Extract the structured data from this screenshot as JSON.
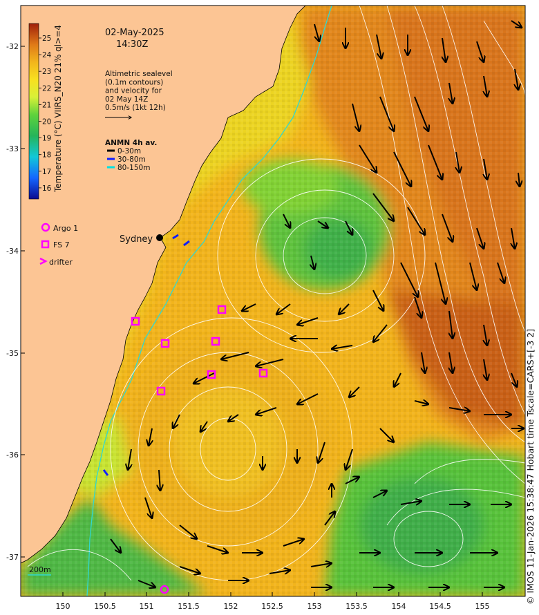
{
  "date": "02-May-2025",
  "time": "14:30Z",
  "altimetry_note": [
    "Altimetric sealevel",
    "(0.1m contours)",
    "and velocity for",
    "02 May 14Z",
    "0.5m/s (1kt 12h)"
  ],
  "anmn_title": "ANMN 4h av.",
  "anmn_items": [
    {
      "label": "0-30m",
      "color": "#000000"
    },
    {
      "label": "30-80m",
      "color": "#1020ff"
    },
    {
      "label": "80-150m",
      "color": "#00e0e0"
    }
  ],
  "colorbar": {
    "title": "Temperature (°C) VIIRS_N20 21% ql>=4",
    "ticks": [
      "25",
      "24",
      "23",
      "22",
      "21",
      "20",
      "19",
      "18",
      "17",
      "16"
    ]
  },
  "legend": {
    "argo_label": "Argo 1",
    "fs_label": "FS 7",
    "drifter_label": "drifter",
    "marker_color": "#ff00ff"
  },
  "city": "Sydney",
  "depth_label": "200m",
  "x_ticks": [
    "150",
    "150.5",
    "151",
    "151.5",
    "152",
    "152.5",
    "153",
    "153.5",
    "154",
    "154.5",
    "155"
  ],
  "y_ticks": [
    "-32",
    "-33",
    "-34",
    "-35",
    "-36",
    "-37"
  ],
  "credit": "© IMOS 11-Jan-2026 15:38:47 Hobart time Tscale=CARS+[-3 2]",
  "colors": {
    "land": "#fcc594",
    "warm_sst": "#e58f1c",
    "mid_sst": "#f5c11a",
    "cool_sst": "#62c83c",
    "contour": "#ffffff",
    "isobath": "#30d8d0"
  }
}
